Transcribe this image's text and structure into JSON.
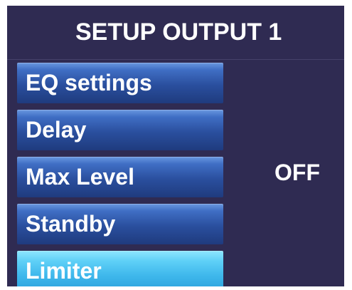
{
  "header": {
    "title": "SETUP OUTPUT 1"
  },
  "menu": {
    "items": [
      {
        "label": "EQ settings",
        "selected": false
      },
      {
        "label": "Delay",
        "selected": false
      },
      {
        "label": "Max Level",
        "selected": false
      },
      {
        "label": "Standby",
        "selected": false
      },
      {
        "label": "Limiter",
        "selected": true
      }
    ]
  },
  "value_panel": {
    "value": "OFF"
  },
  "colors": {
    "background": "#2f2b52",
    "item_gradient_top": "#6a98e0",
    "item_gradient_bottom": "#1f3b7e",
    "selected_gradient_top": "#8fe6ff",
    "selected_gradient_bottom": "#2aa2dc",
    "text": "#ffffff"
  }
}
